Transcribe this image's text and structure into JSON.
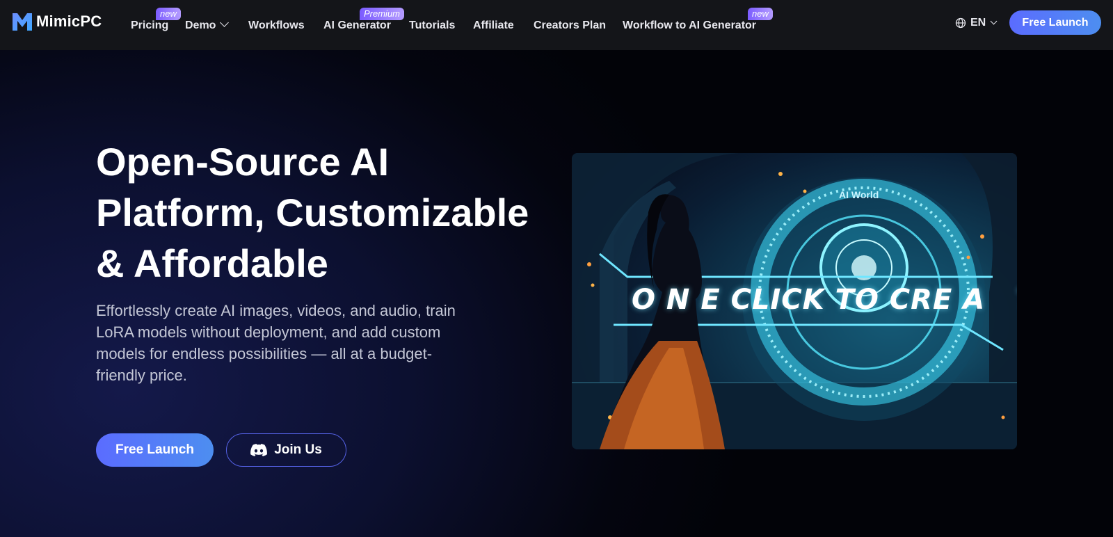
{
  "brand": {
    "name": "MimicPC"
  },
  "nav": {
    "items": [
      {
        "label": "Pricing",
        "badge": "new"
      },
      {
        "label": "Demo",
        "dropdown": true
      },
      {
        "label": "Workflows"
      },
      {
        "label": "AI Generator",
        "badge": "Premium"
      },
      {
        "label": "Tutorials"
      },
      {
        "label": "Affiliate"
      },
      {
        "label": "Creators Plan"
      },
      {
        "label": "Workflow to AI Generator",
        "badge": "new"
      }
    ],
    "language": "EN",
    "cta": "Free Launch"
  },
  "hero": {
    "title_line1": "Open-Source AI",
    "title_line2": "Platform, Customizable",
    "title_line3": "& Affordable",
    "description": "Effortlessly create AI images, videos, and audio, train LoRA models without deployment, and add custom models for endless possibilities — all at a budget-friendly price.",
    "primary_cta": "Free Launch",
    "secondary_cta": "Join Us"
  },
  "hero_image": {
    "overlay_text": "O N E CLICK TO CRE A   TE",
    "portal_label": "AI World"
  },
  "colors": {
    "accent_start": "#5b6cff",
    "accent_end": "#4d8ef0",
    "badge": "#8b6bff",
    "nav_bg": "#141519"
  }
}
